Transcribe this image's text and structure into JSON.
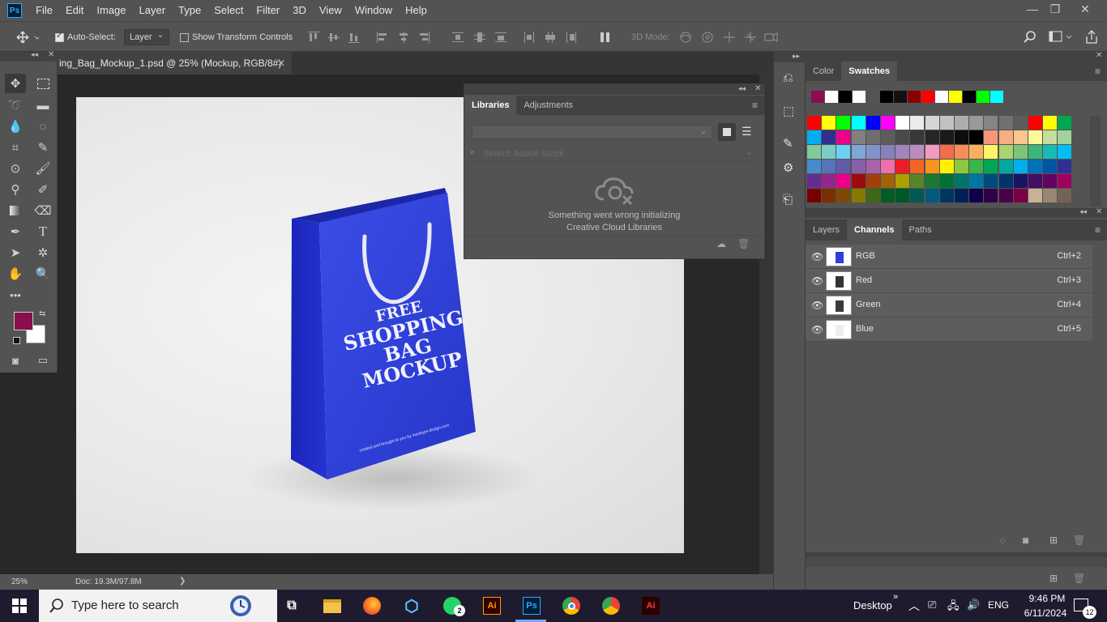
{
  "app": {
    "logo": "Ps"
  },
  "menu": [
    "File",
    "Edit",
    "Image",
    "Layer",
    "Type",
    "Select",
    "Filter",
    "3D",
    "View",
    "Window",
    "Help"
  ],
  "window_controls": {
    "minimize": "—",
    "restore": "❐",
    "close": "✕"
  },
  "options_bar": {
    "auto_select_label": "Auto-Select:",
    "auto_select_value": "Layer",
    "transform_label": "Show Transform Controls",
    "mode_label": "3D Mode:"
  },
  "document": {
    "tab_title": "ing_Bag_Mockup_1.psd @ 25% (Mockup, RGB/8#)",
    "close": "✕",
    "zoom": "25%",
    "doc_size": "Doc: 19.3M/97.8M",
    "status_arrow": "❯"
  },
  "mockup": {
    "line1": "FREE",
    "line2": "SHOPPING",
    "line3": "BAG MOCKUP",
    "credit": "created and brought to you by mockups-design.com",
    "bag_color": "#2f3fd8"
  },
  "libraries_panel": {
    "tabs": [
      "Libraries",
      "Adjustments"
    ],
    "search_placeholder": "Search Adobe Stock",
    "error_line1": "Something went wrong initializing",
    "error_line2": "Creative Cloud Libraries"
  },
  "swatches_panel": {
    "tabs": [
      "Color",
      "Swatches"
    ],
    "recent": [
      "#8a0f4c",
      "#ffffff",
      "#000000",
      "#ffffff",
      "#535353",
      "#000000",
      "#111111",
      "#8a0000",
      "#ff0000",
      "#ffffff",
      "#ffff00",
      "#000000",
      "#00ff00",
      "#00ffff"
    ],
    "grid": [
      [
        "#ff0000",
        "#ffff00",
        "#00ff00",
        "#00ffff",
        "#0000ff",
        "#ff00ff",
        "#ffffff",
        "#ebebeb",
        "#d6d6d6",
        "#c2c2c2",
        "#adadad",
        "#999999",
        "#858585",
        "#707070",
        "#5c5c5c",
        "#ff0000",
        "#ffff00",
        "#00a651"
      ],
      [
        "#00aeef",
        "#2e3192",
        "#ec008c",
        "#808080",
        "#6e6e6e",
        "#5c5c5c",
        "#4a4a4a",
        "#383838",
        "#262626",
        "#1a1a1a",
        "#0d0d0d",
        "#000000",
        "#f7977a",
        "#fbad82",
        "#fdc68c",
        "#fff79a",
        "#c4df9b",
        "#a3d39c"
      ],
      [
        "#82ca9c",
        "#7accc8",
        "#6dcff6",
        "#7da7d9",
        "#8393ca",
        "#8781bd",
        "#a186be",
        "#bd8cbf",
        "#f49ac1",
        "#f26c4f",
        "#f68e56",
        "#fbaf5d",
        "#fff467",
        "#acd372",
        "#7cc576",
        "#3bb878",
        "#1abbb4",
        "#00bff3"
      ],
      [
        "#448ccb",
        "#5574b9",
        "#605ca8",
        "#855fa8",
        "#a763a8",
        "#f06ea9",
        "#ed1c24",
        "#f26522",
        "#f7941d",
        "#fff200",
        "#8dc63f",
        "#39b54a",
        "#00a651",
        "#00a99d",
        "#00aeef",
        "#0072bc",
        "#0054a6",
        "#2e3192"
      ],
      [
        "#662d91",
        "#92278f",
        "#ec008c",
        "#9e0b0f",
        "#a0410d",
        "#a36209",
        "#aba000",
        "#598527",
        "#197b30",
        "#007236",
        "#00746b",
        "#0076a3",
        "#004b80",
        "#003471",
        "#1b1464",
        "#440e62",
        "#630460",
        "#9e005d"
      ],
      [
        "#790000",
        "#7b2e00",
        "#7d4900",
        "#827b00",
        "#406618",
        "#005e20",
        "#005826",
        "#005952",
        "#005b7f",
        "#003663",
        "#002157",
        "#0d004c",
        "#32004b",
        "#4b0049",
        "#7b0046",
        "#c7b299",
        "#998675",
        "#736357"
      ]
    ]
  },
  "channels_panel": {
    "tabs": [
      "Layers",
      "Channels",
      "Paths"
    ],
    "rows": [
      {
        "name": "RGB",
        "shortcut": "Ctrl+2",
        "thumb": "#2f3fd8"
      },
      {
        "name": "Red",
        "shortcut": "Ctrl+3",
        "thumb": "#333333"
      },
      {
        "name": "Green",
        "shortcut": "Ctrl+4",
        "thumb": "#3a3a3a"
      },
      {
        "name": "Blue",
        "shortcut": "Ctrl+5",
        "thumb": "#eeeeee"
      }
    ]
  },
  "colors": {
    "foreground": "#8a0f4c",
    "background": "#ffffff"
  },
  "taskbar": {
    "search_placeholder": "Type here to search",
    "desktop_label": "Desktop",
    "language": "ENG",
    "time": "9:46 PM",
    "date": "6/11/2024",
    "whatsapp_badge": "2",
    "notification_badge": "12",
    "apps": [
      "task-view",
      "file-explorer",
      "firefox",
      "3d-viewer",
      "whatsapp",
      "illustrator",
      "photoshop",
      "chrome",
      "chrome-profile",
      "illustrator-dark"
    ],
    "ai_label": "Ai",
    "ps_label": "Ps"
  }
}
